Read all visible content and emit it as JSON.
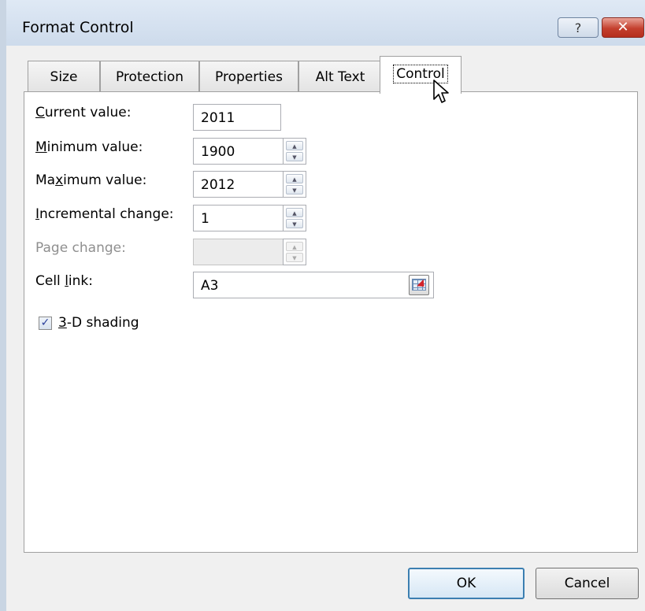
{
  "window": {
    "title": "Format Control",
    "help_glyph": "?",
    "close_glyph": "✕"
  },
  "tabs": [
    {
      "label": "Size",
      "active": false
    },
    {
      "label": "Protection",
      "active": false
    },
    {
      "label": "Properties",
      "active": false
    },
    {
      "label": "Alt Text",
      "active": false
    },
    {
      "label": "Control",
      "active": true
    }
  ],
  "form": {
    "current_value": {
      "pre": "",
      "key": "C",
      "post": "urrent value:",
      "value": "2011"
    },
    "minimum_value": {
      "pre": "",
      "key": "M",
      "post": "inimum value:",
      "value": "1900"
    },
    "maximum_value": {
      "pre": "Ma",
      "key": "x",
      "post": "imum value:",
      "value": "2012"
    },
    "incremental_change": {
      "pre": "",
      "key": "I",
      "post": "ncremental change:",
      "value": "1"
    },
    "page_change": {
      "label": "Page change:",
      "value": "",
      "disabled": true
    },
    "cell_link": {
      "pre": "Cell ",
      "key": "l",
      "post": "ink:",
      "value": "A3"
    },
    "shading": {
      "key": "3",
      "post": "-D shading",
      "checked": true,
      "check_glyph": "✓"
    }
  },
  "buttons": {
    "ok": "OK",
    "cancel": "Cancel"
  },
  "colors": {
    "title_bar": "#c7d6e8",
    "close_button": "#c4402e",
    "default_button_border": "#3c7fb1"
  },
  "icons": {
    "cursor": "arrow-pointer-icon",
    "cell_link_picker": "collapse-dialog-icon"
  }
}
